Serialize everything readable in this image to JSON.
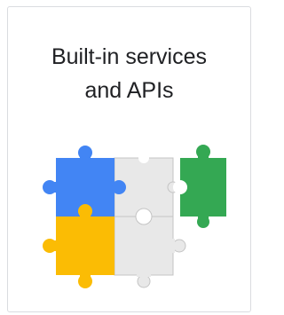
{
  "card": {
    "title_line1": "Built-in services",
    "title_line2": "and APIs",
    "illustration": "puzzle-pieces-icon"
  },
  "colors": {
    "blue": "#4285F4",
    "green": "#34A853",
    "yellow": "#FBBC04",
    "gray": "#E8E8E8",
    "gray_stroke": "#C4C4C4",
    "text": "#202124",
    "border": "#DADCE0"
  }
}
